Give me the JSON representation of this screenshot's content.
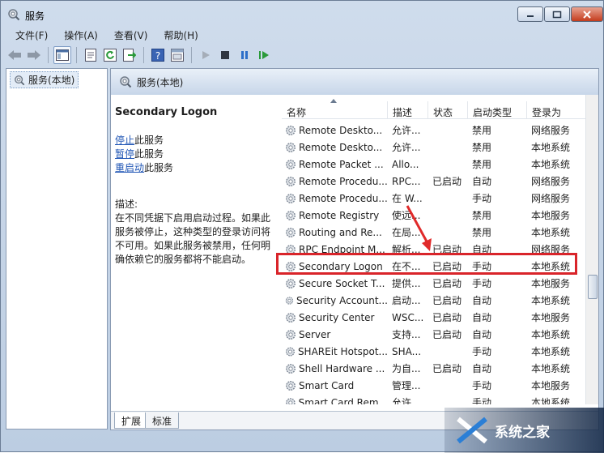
{
  "window": {
    "title": "服务"
  },
  "menu": [
    {
      "label": "文件(F)"
    },
    {
      "label": "操作(A)"
    },
    {
      "label": "查看(V)"
    },
    {
      "label": "帮助(H)"
    }
  ],
  "tree": {
    "item": "服务(本地)"
  },
  "header": {
    "title": "服务(本地)"
  },
  "detail": {
    "service_name": "Secondary Logon",
    "stop_link": "停止",
    "stop_suffix": "此服务",
    "pause_link": "暂停",
    "pause_suffix": "此服务",
    "restart_link": "重启动",
    "restart_suffix": "此服务",
    "desc_label": "描述:",
    "desc_text": "在不同凭据下启用启动过程。如果此服务被停止，这种类型的登录访问将不可用。如果此服务被禁用，任何明确依赖它的服务都将不能启动。"
  },
  "columns": [
    "名称",
    "描述",
    "状态",
    "启动类型",
    "登录为"
  ],
  "rows": [
    {
      "name": "Remote Deskto...",
      "desc": "允许...",
      "status": "",
      "startup": "禁用",
      "logon": "网络服务"
    },
    {
      "name": "Remote Deskto...",
      "desc": "允许...",
      "status": "",
      "startup": "禁用",
      "logon": "本地系统"
    },
    {
      "name": "Remote Packet ...",
      "desc": "Allo...",
      "status": "",
      "startup": "禁用",
      "logon": "本地系统"
    },
    {
      "name": "Remote Procedu...",
      "desc": "RPC...",
      "status": "已启动",
      "startup": "自动",
      "logon": "网络服务"
    },
    {
      "name": "Remote Procedu...",
      "desc": "在 W...",
      "status": "",
      "startup": "手动",
      "logon": "网络服务"
    },
    {
      "name": "Remote Registry",
      "desc": "使远...",
      "status": "",
      "startup": "禁用",
      "logon": "本地服务"
    },
    {
      "name": "Routing and Re...",
      "desc": "在局...",
      "status": "",
      "startup": "禁用",
      "logon": "本地系统"
    },
    {
      "name": "RPC Endpoint M...",
      "desc": "解析...",
      "status": "已启动",
      "startup": "自动",
      "logon": "网络服务"
    },
    {
      "name": "Secondary Logon",
      "desc": "在不...",
      "status": "已启动",
      "startup": "手动",
      "logon": "本地系统"
    },
    {
      "name": "Secure Socket T...",
      "desc": "提供...",
      "status": "已启动",
      "startup": "手动",
      "logon": "本地服务"
    },
    {
      "name": "Security Account...",
      "desc": "启动...",
      "status": "已启动",
      "startup": "自动",
      "logon": "本地系统"
    },
    {
      "name": "Security Center",
      "desc": "WSC...",
      "status": "已启动",
      "startup": "自动",
      "logon": "本地服务"
    },
    {
      "name": "Server",
      "desc": "支持...",
      "status": "已启动",
      "startup": "自动",
      "logon": "本地系统"
    },
    {
      "name": "SHAREit Hotspot...",
      "desc": "SHA...",
      "status": "",
      "startup": "手动",
      "logon": "本地系统"
    },
    {
      "name": "Shell Hardware ...",
      "desc": "为自...",
      "status": "已启动",
      "startup": "自动",
      "logon": "本地系统"
    },
    {
      "name": "Smart Card",
      "desc": "管理...",
      "status": "",
      "startup": "手动",
      "logon": "本地服务"
    },
    {
      "name": "Smart Card Rem...",
      "desc": "允许...",
      "status": "",
      "startup": "手动",
      "logon": "本地系统"
    }
  ],
  "tabs": [
    {
      "label": "扩展"
    },
    {
      "label": "标准"
    }
  ],
  "watermark": {
    "text": "系统之家"
  },
  "colors": {
    "highlight": "#d9242a",
    "link": "#1f55b5"
  }
}
